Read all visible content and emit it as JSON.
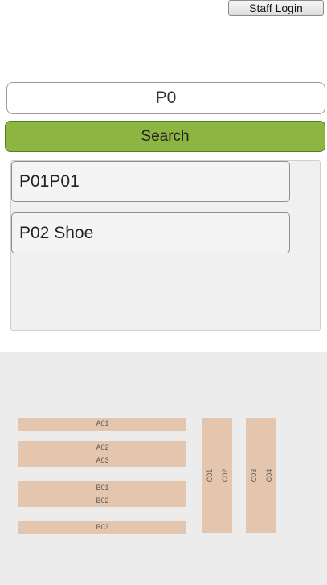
{
  "header": {
    "staff_login_label": "Staff Login"
  },
  "search": {
    "query": "P0",
    "button_label": "Search"
  },
  "results": [
    {
      "label": "P01P01"
    },
    {
      "label": "P02 Shoe"
    }
  ],
  "map": {
    "shelf_labels": {
      "a01": "A01",
      "a02": "A02",
      "a03": "A03",
      "b01": "B01",
      "b02": "B02",
      "b03": "B03",
      "c01": "C01",
      "c02": "C02",
      "c03": "C03",
      "c04": "C04"
    },
    "shelf_color": "#e4c6ae",
    "floor_color": "#ececec"
  },
  "colors": {
    "search_button": "#8db542"
  }
}
